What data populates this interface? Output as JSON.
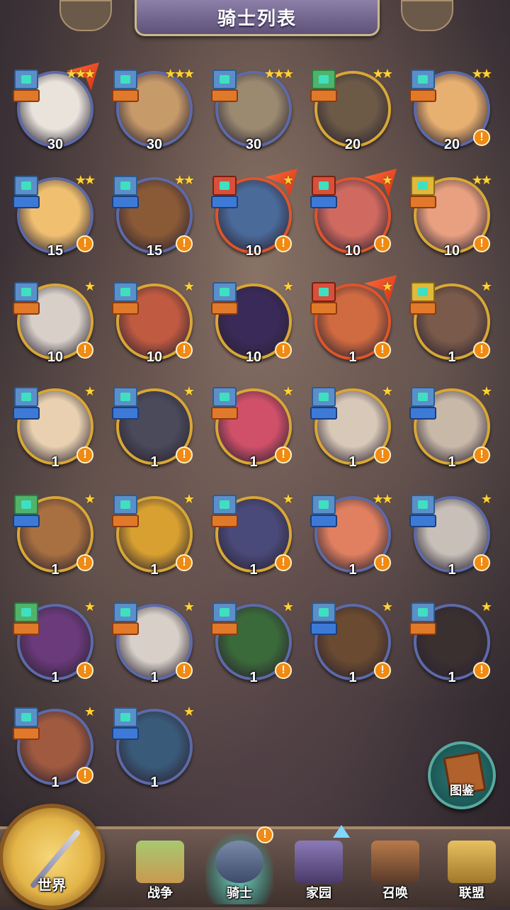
{
  "title": "骑士列表",
  "knights": [
    {
      "level": "30",
      "stars": "★★★",
      "frame": "blue",
      "flag": true,
      "alert": false,
      "top": "blue",
      "bot": "orange",
      "face": "#e9e3dc"
    },
    {
      "level": "30",
      "stars": "★★★",
      "frame": "blue",
      "flag": false,
      "alert": false,
      "top": "blue",
      "bot": "orange",
      "face": "#c79a6a"
    },
    {
      "level": "30",
      "stars": "★★★",
      "frame": "blue",
      "flag": false,
      "alert": false,
      "top": "blue",
      "bot": "orange",
      "face": "#9b8a70"
    },
    {
      "level": "20",
      "stars": "★★",
      "frame": "gold",
      "flag": false,
      "alert": false,
      "top": "green",
      "bot": "orange",
      "face": "#6c5a46"
    },
    {
      "level": "20",
      "stars": "★★",
      "frame": "blue",
      "flag": false,
      "alert": true,
      "top": "blue",
      "bot": "orange",
      "face": "#e8b070"
    },
    {
      "level": "15",
      "stars": "★★",
      "frame": "blue",
      "flag": false,
      "alert": true,
      "top": "blue",
      "bot": "blue",
      "face": "#f0c070"
    },
    {
      "level": "15",
      "stars": "★★",
      "frame": "blue",
      "flag": false,
      "alert": true,
      "top": "blue",
      "bot": "blue",
      "face": "#8a5a36"
    },
    {
      "level": "10",
      "stars": "★",
      "frame": "red",
      "flag": true,
      "alert": true,
      "top": "red",
      "bot": "blue",
      "face": "#4a6a9a"
    },
    {
      "level": "10",
      "stars": "★",
      "frame": "red",
      "flag": true,
      "alert": true,
      "top": "red",
      "bot": "blue",
      "face": "#d06a60"
    },
    {
      "level": "10",
      "stars": "★★",
      "frame": "gold",
      "flag": false,
      "alert": true,
      "top": "yellow",
      "bot": "orange",
      "face": "#e8a080"
    },
    {
      "level": "10",
      "stars": "★",
      "frame": "gold",
      "flag": false,
      "alert": true,
      "top": "blue",
      "bot": "orange",
      "face": "#d8d0c8"
    },
    {
      "level": "10",
      "stars": "★",
      "frame": "gold",
      "flag": false,
      "alert": true,
      "top": "blue",
      "bot": "orange",
      "face": "#c05a40"
    },
    {
      "level": "10",
      "stars": "★",
      "frame": "gold",
      "flag": false,
      "alert": true,
      "top": "blue",
      "bot": "orange",
      "face": "#3a2a5a"
    },
    {
      "level": "1",
      "stars": "★",
      "frame": "red",
      "flag": true,
      "alert": true,
      "top": "red",
      "bot": "orange",
      "face": "#d06a40"
    },
    {
      "level": "1",
      "stars": "★",
      "frame": "gold",
      "flag": false,
      "alert": true,
      "top": "yellow",
      "bot": "orange",
      "face": "#7a5a4a"
    },
    {
      "level": "1",
      "stars": "★",
      "frame": "gold",
      "flag": false,
      "alert": true,
      "top": "blue",
      "bot": "blue",
      "face": "#e8d0b0"
    },
    {
      "level": "1",
      "stars": "★",
      "frame": "gold",
      "flag": false,
      "alert": true,
      "top": "blue",
      "bot": "blue",
      "face": "#4a4a5a"
    },
    {
      "level": "1",
      "stars": "★",
      "frame": "gold",
      "flag": false,
      "alert": true,
      "top": "blue",
      "bot": "orange",
      "face": "#d0506a"
    },
    {
      "level": "1",
      "stars": "★",
      "frame": "gold",
      "flag": false,
      "alert": true,
      "top": "blue",
      "bot": "blue",
      "face": "#d8c8b8"
    },
    {
      "level": "1",
      "stars": "★",
      "frame": "gold",
      "flag": false,
      "alert": true,
      "top": "blue",
      "bot": "blue",
      "face": "#c8b8a8"
    },
    {
      "level": "1",
      "stars": "★",
      "frame": "gold",
      "flag": false,
      "alert": true,
      "top": "green",
      "bot": "blue",
      "face": "#a87040"
    },
    {
      "level": "1",
      "stars": "★",
      "frame": "gold",
      "flag": false,
      "alert": true,
      "top": "blue",
      "bot": "orange",
      "face": "#d8a030"
    },
    {
      "level": "1",
      "stars": "★",
      "frame": "gold",
      "flag": false,
      "alert": true,
      "top": "blue",
      "bot": "orange",
      "face": "#4a4a7a"
    },
    {
      "level": "1",
      "stars": "★★",
      "frame": "blue",
      "flag": false,
      "alert": true,
      "top": "blue",
      "bot": "blue",
      "face": "#e08060"
    },
    {
      "level": "1",
      "stars": "★",
      "frame": "blue",
      "flag": false,
      "alert": true,
      "top": "blue",
      "bot": "blue",
      "face": "#c8c0b8"
    },
    {
      "level": "1",
      "stars": "★",
      "frame": "blue",
      "flag": false,
      "alert": true,
      "top": "green",
      "bot": "orange",
      "face": "#6a3a7a"
    },
    {
      "level": "1",
      "stars": "★",
      "frame": "blue",
      "flag": false,
      "alert": true,
      "top": "blue",
      "bot": "orange",
      "face": "#d8d0c8"
    },
    {
      "level": "1",
      "stars": "★",
      "frame": "blue",
      "flag": false,
      "alert": true,
      "top": "blue",
      "bot": "orange",
      "face": "#3a6a3a"
    },
    {
      "level": "1",
      "stars": "★",
      "frame": "blue",
      "flag": false,
      "alert": true,
      "top": "blue",
      "bot": "blue",
      "face": "#6a4a30"
    },
    {
      "level": "1",
      "stars": "★",
      "frame": "blue",
      "flag": false,
      "alert": true,
      "top": "blue",
      "bot": "orange",
      "face": "#3a3030"
    },
    {
      "level": "1",
      "stars": "★",
      "frame": "blue",
      "flag": false,
      "alert": true,
      "top": "blue",
      "bot": "orange",
      "face": "#a05a40"
    },
    {
      "level": "1",
      "stars": "★",
      "frame": "blue",
      "flag": false,
      "alert": false,
      "top": "blue",
      "bot": "blue",
      "face": "#3a5a7a"
    }
  ],
  "collection_label": "图鉴",
  "nav": {
    "world": "世界",
    "war": "战争",
    "knight": "骑士",
    "home": "家园",
    "summon": "召唤",
    "alliance": "联盟",
    "alert_mark": "!"
  }
}
